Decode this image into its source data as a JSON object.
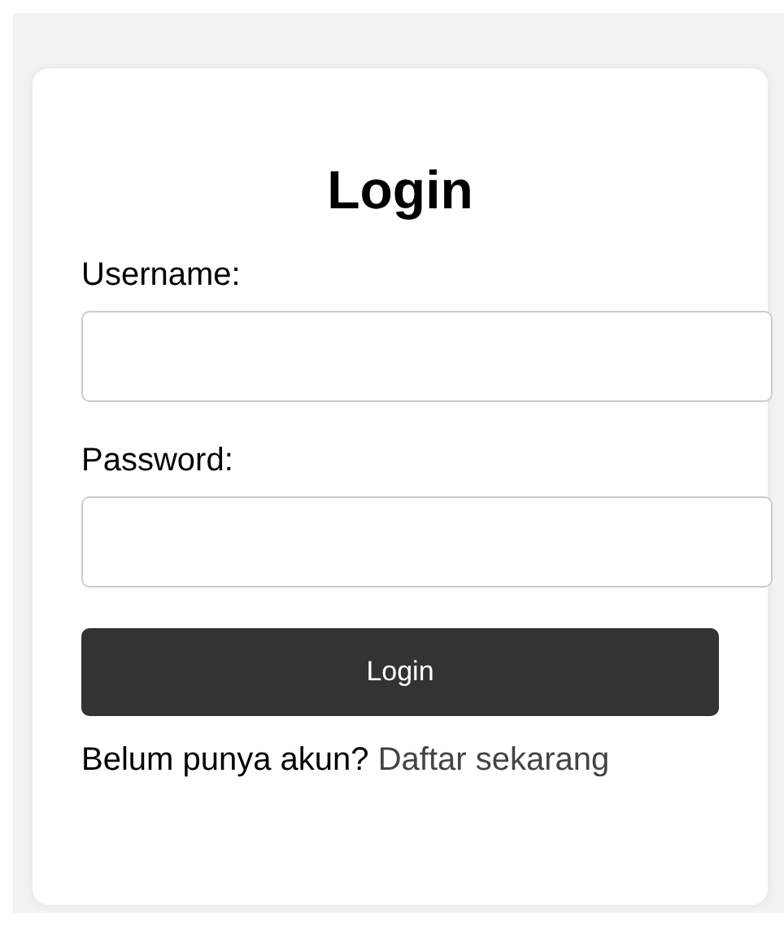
{
  "title": "Login",
  "fields": [
    {
      "label": "Username:"
    },
    {
      "label": "Password:"
    }
  ],
  "button": "Login",
  "footer": {
    "text": "Belum punya akun?",
    "link": "Daftar sekarang"
  }
}
